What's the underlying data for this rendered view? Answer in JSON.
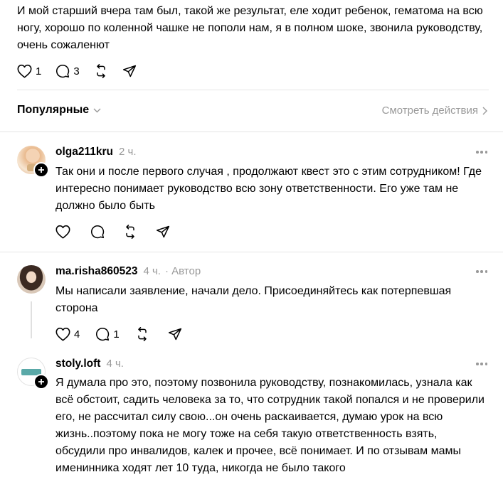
{
  "top_post": {
    "text": "И мой старший вчера там был, такой же результат, еле ходит ребенок, гематома на всю ногу, хорошо по коленной чашке не пополи нам, я в полном шоке, звонила руководству, очень сожаленют",
    "likes": "1",
    "replies": "3"
  },
  "filter_bar": {
    "sort_label": "Популярные",
    "see_activity_label": "Смотреть действия"
  },
  "comments": [
    {
      "username": "olga211kru",
      "time": "2 ч.",
      "author_tag": "",
      "text": "Так они и после первого случая , продолжают квест это с этим сотрудником! Где интересно понимает руководство всю зону ответственности. Его уже там не должно было быть",
      "likes": "",
      "replies": ""
    },
    {
      "username": "ma.risha860523",
      "time": "4 ч.",
      "author_tag": "· Автор",
      "text": "Мы написали заявление, начали дело. Присоединяйтесь как потерпевшая сторона",
      "likes": "4",
      "replies": "1"
    },
    {
      "username": "stoly.loft",
      "time": "4 ч.",
      "author_tag": "",
      "text": "Я думала про это, поэтому позвонила руководству, познакомилась, узнала как всё обстоит, садить человека за то, что сотрудник такой попался и не проверили его, не рассчитал силу свою...он очень раскаивается, думаю урок на всю жизнь..поэтому пока не могу тоже на себя такую ответственность взять, обсудили про инвалидов, калек и прочее, всё понимает. И по отзывам мамы именинника ходят лет 10 туда, никогда не было такого",
      "likes": "",
      "replies": ""
    }
  ],
  "icons": {
    "like": "heart-icon",
    "reply": "speech-bubble-icon",
    "repost": "repost-icon",
    "share": "paper-plane-icon",
    "follow": "plus-icon",
    "more": "more-dots-icon"
  },
  "colors": {
    "text": "#000000",
    "muted": "#999999",
    "divider": "#e5e5e5"
  }
}
